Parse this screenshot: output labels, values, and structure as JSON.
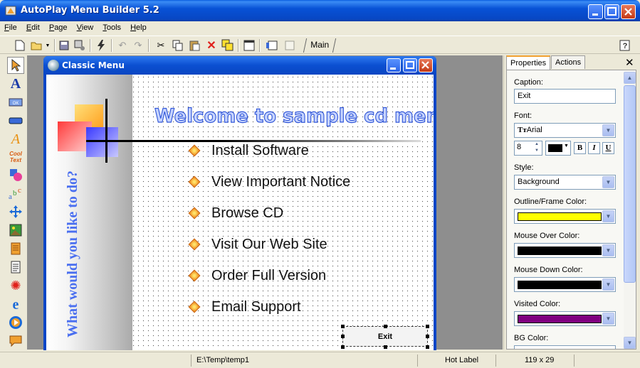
{
  "window": {
    "title": "AutoPlay Menu Builder 5.2"
  },
  "menubar": {
    "items": [
      {
        "label": "File",
        "ul": "F",
        "rest": "ile"
      },
      {
        "label": "Edit",
        "ul": "E",
        "rest": "dit"
      },
      {
        "label": "Page",
        "ul": "P",
        "rest": "age"
      },
      {
        "label": "View",
        "ul": "V",
        "rest": "iew"
      },
      {
        "label": "Tools",
        "ul": "T",
        "rest": "ools"
      },
      {
        "label": "Help",
        "ul": "H",
        "rest": "elp"
      }
    ]
  },
  "toolbar": {
    "page_tab": "Main"
  },
  "child_window": {
    "title": "Classic Menu"
  },
  "canvas": {
    "welcome": "Welcome to sample cd menu",
    "side_text": "What would you like to do?",
    "menu_items": [
      "Install Software",
      "View Important Notice",
      "Browse CD",
      "Visit Our Web Site",
      "Order Full Version",
      "Email Support"
    ],
    "exit_label": "Exit"
  },
  "panel": {
    "tab_properties": "Properties",
    "tab_actions": "Actions",
    "caption_label": "Caption:",
    "caption_value": "Exit",
    "font_label": "Font:",
    "font_value": "Arial",
    "font_size": "8",
    "bold": "B",
    "italic": "I",
    "underline": "U",
    "style_label": "Style:",
    "style_value": "Background",
    "outline_label": "Outline/Frame Color:",
    "mouseover_label": "Mouse Over Color:",
    "mousedown_label": "Mouse Down Color:",
    "visited_label": "Visited Color:",
    "bg_label": "BG Color:",
    "colors": {
      "outline": "#ffff00",
      "mouseover": "#000000",
      "mousedown": "#000000",
      "visited": "#800080",
      "font_color": "#000000"
    }
  },
  "status": {
    "path": "E:\\Temp\\temp1",
    "object_type": "Hot Label",
    "size": "119 x 29"
  }
}
